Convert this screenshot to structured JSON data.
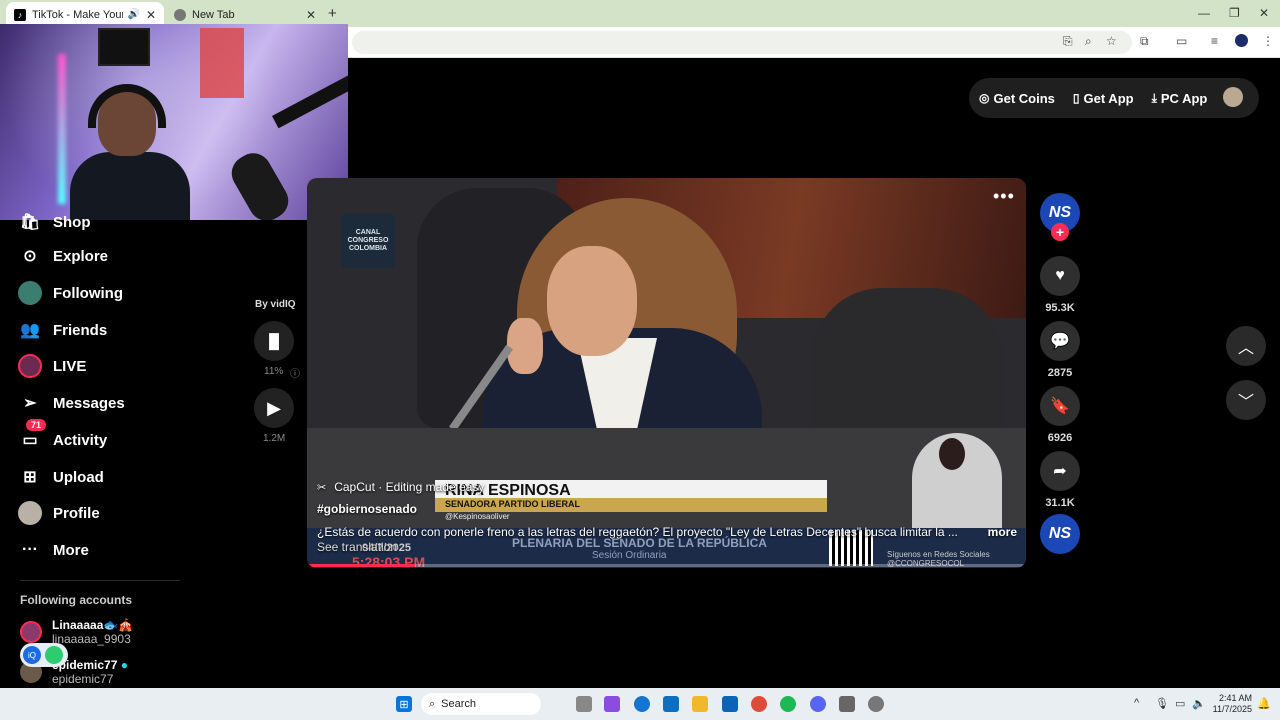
{
  "browser": {
    "tabs": [
      {
        "title": "TikTok - Make Your Day",
        "active": true
      },
      {
        "title": "New Tab",
        "active": false
      }
    ]
  },
  "topnav": {
    "coins": "Get Coins",
    "app": "Get App",
    "pc_app": "PC App"
  },
  "sidebar": {
    "items": [
      {
        "label": "Shop",
        "icon": "shop-icon"
      },
      {
        "label": "Explore",
        "icon": "compass-icon"
      },
      {
        "label": "Following",
        "icon": "avatar-icon"
      },
      {
        "label": "Friends",
        "icon": "friends-icon"
      },
      {
        "label": "LIVE",
        "icon": "live-icon"
      },
      {
        "label": "Messages",
        "icon": "paper-plane-icon"
      },
      {
        "label": "Activity",
        "icon": "inbox-icon",
        "badge": "71"
      },
      {
        "label": "Upload",
        "icon": "plus-square-icon"
      },
      {
        "label": "Profile",
        "icon": "profile-avatar"
      },
      {
        "label": "More",
        "icon": "dots-icon"
      }
    ],
    "following_title": "Following accounts",
    "accounts": [
      {
        "name": "Linaaaaa🐟🎪",
        "handle": "linaaaaa_9903"
      },
      {
        "name": "epidemic77",
        "handle": "epidemic77"
      }
    ]
  },
  "vidiq": {
    "label": "By vidIQ",
    "percent": "11%",
    "views": "1.2M"
  },
  "video": {
    "channel_logo": "CANAL CONGRESO COLOMBIA",
    "lower_third_name": "RINA ESPINOSA",
    "lower_third_title": "SENADORA PARTIDO LIBERAL",
    "lower_third_handle": "@Kespinosaoliver",
    "banner_main": "PLENARIA DEL SENADO DE LA REPÚBLICA",
    "banner_sub": "Sesión Ordinaria",
    "date": "04/7/2025",
    "time": "5:28:03 PM",
    "social": "Síguenos en Redes Sociales @CCONGRESOCOL",
    "capcut": "CapCut · Editing made easy",
    "tag": "#gobiernosenado",
    "caption": "¿Estás de acuerdo con ponerle freno a las letras del reggaetón? El proyecto \"Ley de Letras Decentes\" busca limitar la ...",
    "more": "more",
    "translate": "See translation",
    "progress": 0.15
  },
  "actions": {
    "author_initials": "NS",
    "likes": "95.3K",
    "comments": "2875",
    "saves": "6926",
    "shares": "31.1K"
  },
  "taskbar": {
    "search": "Search",
    "time": "2:41 AM",
    "date": "11/7/2025"
  },
  "colors": {
    "accent": "#fe2c55",
    "background": "#000000",
    "ns_blue": "#1b47b7"
  }
}
